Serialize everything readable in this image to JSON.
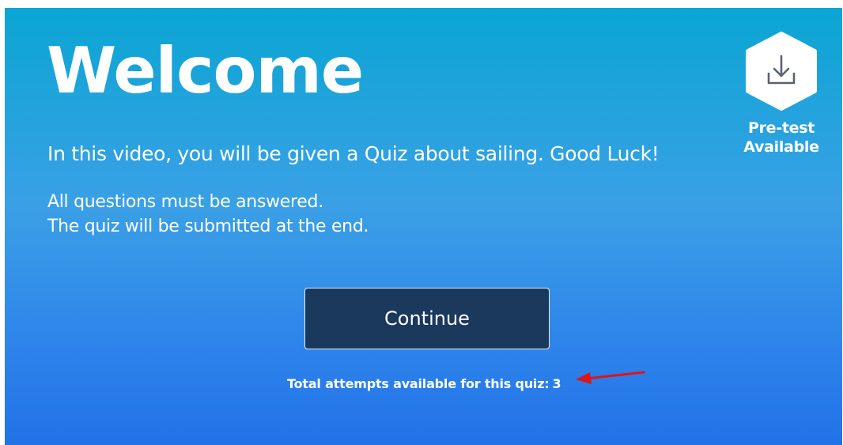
{
  "welcome": {
    "title": "Welcome",
    "intro": "In this video, you will be given a Quiz about sailing. Good Luck!",
    "rules": [
      "All questions must be answered.",
      "The quiz will be submitted at the end."
    ]
  },
  "pretest": {
    "icon": "download-icon",
    "label_line1": "Pre-test",
    "label_line2": "Available"
  },
  "actions": {
    "continue_label": "Continue"
  },
  "attempts": {
    "label": "Total attempts available for this quiz:",
    "count": "3"
  },
  "colors": {
    "panel_top": "#0aa6d3",
    "panel_bottom": "#2272e8",
    "button_bg": "#1b385d",
    "annotation_arrow": "#e0141c"
  }
}
